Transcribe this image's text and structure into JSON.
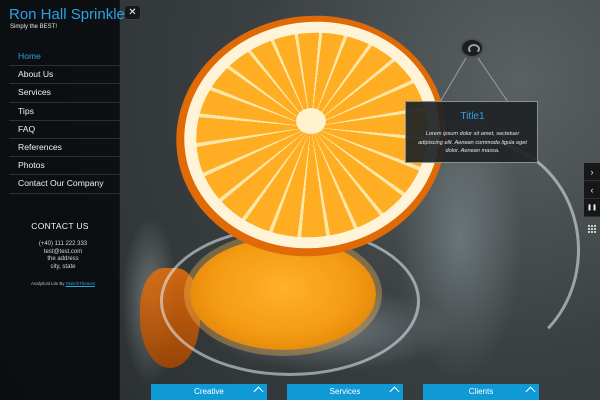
{
  "site": {
    "title": "Ron Hall Sprinklers",
    "tagline": "Simply the BEST!"
  },
  "nav": {
    "items": [
      {
        "label": "Home",
        "active": true
      },
      {
        "label": "About Us"
      },
      {
        "label": "Services"
      },
      {
        "label": "Tips"
      },
      {
        "label": "FAQ"
      },
      {
        "label": "References"
      },
      {
        "label": "Photos"
      },
      {
        "label": "Contact Our Company"
      }
    ]
  },
  "contact": {
    "title": "CONTACT US",
    "phone": "(+40) 111 222 333",
    "email": "test@test.com",
    "address": "the address",
    "city": "city, state"
  },
  "credits": {
    "text": "Analytical Lite By",
    "link": "SketchThemes"
  },
  "controls": {
    "close_icon": "✕",
    "next_icon": "›",
    "prev_icon": "‹",
    "pause_icon": "❚❚"
  },
  "tooltip": {
    "title": "Title1",
    "body": "Lorem ipsum dolor sit amet, sectetuer adipiscing elit. Aenean commodo ligula eget dolor. Aenean massa."
  },
  "tabs": [
    {
      "label": "Creative"
    },
    {
      "label": "Services"
    },
    {
      "label": "Clients"
    }
  ],
  "colors": {
    "accent": "#2aa3e6",
    "tab_bg": "#0f9ad6",
    "sidebar_bg": "#080a0c"
  }
}
